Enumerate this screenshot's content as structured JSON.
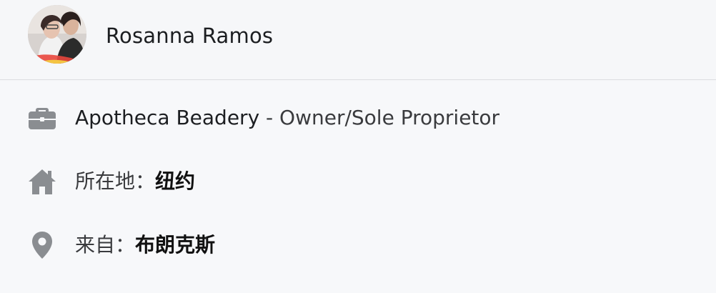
{
  "profile": {
    "name": "Rosanna Ramos",
    "avatar_icon": "profile-photo"
  },
  "work": {
    "icon": "briefcase-icon",
    "company": "Apotheca Beadery",
    "separator": " - ",
    "role": "Owner/Sole Proprietor"
  },
  "lives_in": {
    "icon": "home-icon",
    "label": "所在地：",
    "value": "纽约"
  },
  "from": {
    "icon": "location-pin-icon",
    "label": "来自：",
    "value": "布朗克斯"
  },
  "colors": {
    "icon_gray": "#8a8d91",
    "text": "#1c1e21",
    "divider": "#dcdde1"
  }
}
